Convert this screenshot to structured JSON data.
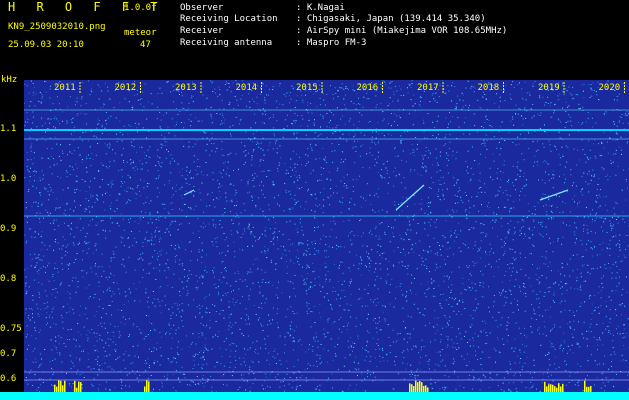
{
  "header": {
    "program": "H R O F F T",
    "version": "1.0.0f",
    "filename": "KN9_2509032010.png",
    "datetime": "25.09.03 20:10",
    "meteor_label": "meteor",
    "meteor_count": "47",
    "info": [
      {
        "label": "Observer",
        "value": ": K.Nagai"
      },
      {
        "label": "Receiving Location",
        "value": ": Chigasaki, Japan (139.414 35.340)"
      },
      {
        "label": "Receiver",
        "value": ": AirSpy mini (Miakejima VOR 108.65MHz)"
      },
      {
        "label": "Receiving antenna",
        "value": ": Maspro FM-3"
      }
    ]
  },
  "axis": {
    "unit": "kHz",
    "y_ticks": [
      "1.1",
      "1.0",
      "0.9",
      "0.8",
      "0.75",
      "0.7",
      "0.6"
    ],
    "time_labels": [
      "2011",
      "2012",
      "2013",
      "2014",
      "2015",
      "2016",
      "2017",
      "2018",
      "2019",
      "2020"
    ]
  },
  "colors": {
    "background": "#1a2a9e",
    "noise": "#2fa8ff",
    "carrier": "#00e5ff",
    "label": "#ffff00",
    "bottombar": "#00ffff"
  }
}
